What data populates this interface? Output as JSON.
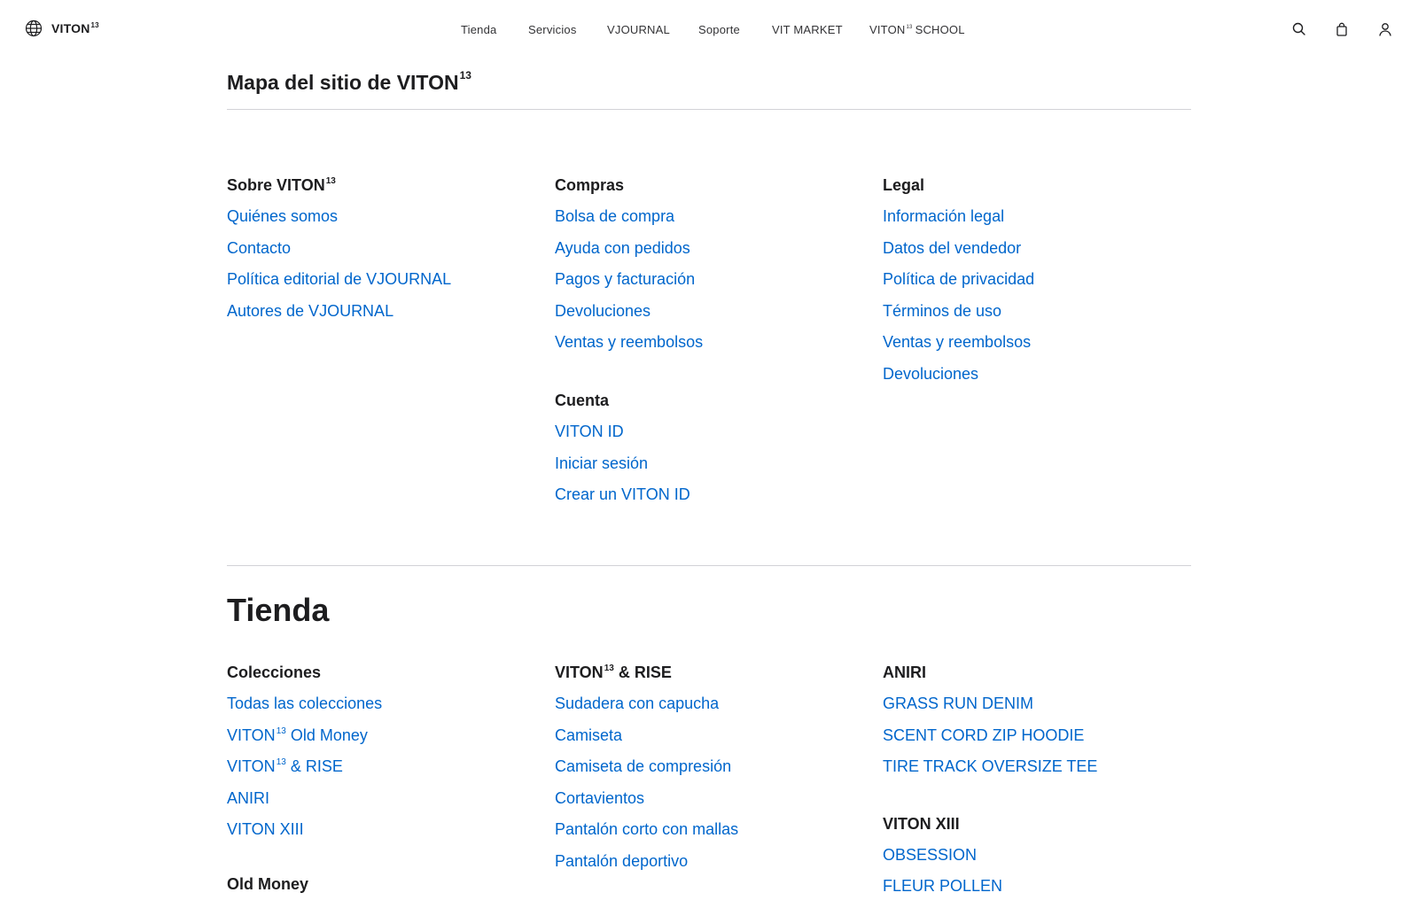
{
  "header": {
    "brand": {
      "name": "VITON",
      "sup": "13",
      "icon": "globe-icon"
    },
    "nav": [
      {
        "label": "Tienda"
      },
      {
        "label": "Servicios"
      },
      {
        "label": "VJOURNAL"
      },
      {
        "label": "Soporte"
      },
      {
        "label": "VIT MARKET"
      },
      {
        "label": "VITON",
        "sup": "13",
        "suffix": "SCHOOL"
      }
    ],
    "icons": [
      "search-icon",
      "shopping-bag-icon",
      "account-icon"
    ]
  },
  "page_title": {
    "text": "Mapa del sitio de VITON",
    "sup": "13"
  },
  "sections": {
    "about": {
      "heading": {
        "text": "Sobre VITON",
        "sup": "13"
      },
      "links": [
        "Quiénes somos",
        "Contacto",
        "Política editorial de VJOURNAL",
        "Autores de VJOURNAL"
      ]
    },
    "shopping": {
      "heading": "Compras",
      "links": [
        "Bolsa de compra",
        "Ayuda con pedidos",
        "Pagos y facturación",
        "Devoluciones",
        "Ventas y reembolsos"
      ]
    },
    "account": {
      "heading": "Cuenta",
      "links": [
        "VITON ID",
        "Iniciar sesión",
        "Crear un VITON ID"
      ]
    },
    "legal": {
      "heading": "Legal",
      "links": [
        "Información legal",
        "Datos del vendedor",
        "Política de privacidad",
        "Términos de uso",
        "Ventas y reembolsos",
        "Devoluciones"
      ]
    }
  },
  "store": {
    "title": "Tienda",
    "collections": {
      "heading": "Colecciones",
      "links": [
        {
          "text": "Todas las colecciones"
        },
        {
          "text": "VITON",
          "sup": "13",
          "suffix": " Old Money"
        },
        {
          "text": "VITON",
          "sup": "13",
          "suffix": " & RISE"
        },
        {
          "text": "ANIRI"
        },
        {
          "text": "VITON XIII"
        }
      ]
    },
    "old_money": {
      "heading": "Old Money"
    },
    "rise": {
      "heading": {
        "text": "VITON",
        "sup": "13",
        "suffix": " & RISE"
      },
      "links": [
        "Sudadera con capucha",
        "Camiseta",
        "Camiseta de compresión",
        "Cortavientos",
        "Pantalón corto con mallas",
        "Pantalón deportivo"
      ]
    },
    "aniri": {
      "heading": "ANIRI",
      "links": [
        "GRASS RUN DENIM",
        "SCENT CORD ZIP HOODIE",
        "TIRE TRACK OVERSIZE TEE"
      ]
    },
    "xiii": {
      "heading": "VITON XIII",
      "links": [
        "OBSESSION",
        "FLEUR POLLEN"
      ]
    }
  },
  "colors": {
    "link": "#0066cc",
    "text": "#1d1d1f",
    "rule": "#d2d2d7"
  }
}
